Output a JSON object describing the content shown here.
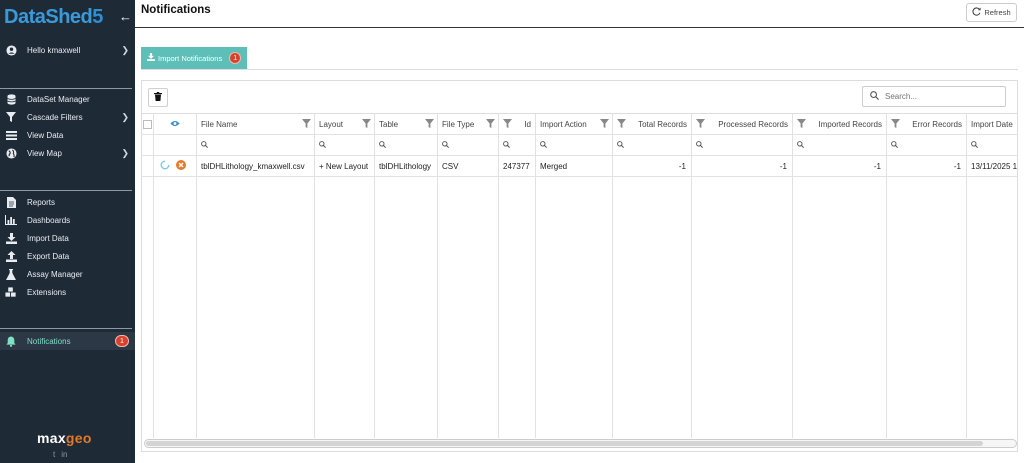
{
  "sidebar": {
    "brand_name": "DataShed",
    "brand_number": "5",
    "user_label": "Hello kmaxwell",
    "items": [
      {
        "label": "DataSet Manager",
        "icon": "database-icon"
      },
      {
        "label": "Cascade Filters",
        "icon": "filter-icon"
      },
      {
        "label": "View Data",
        "icon": "table-icon"
      },
      {
        "label": "View Map",
        "icon": "globe-icon"
      },
      {
        "label": "Reports",
        "icon": "document-icon"
      },
      {
        "label": "Dashboards",
        "icon": "bar-chart-icon"
      },
      {
        "label": "Import Data",
        "icon": "download-icon"
      },
      {
        "label": "Export Data",
        "icon": "upload-icon"
      },
      {
        "label": "Assay Manager",
        "icon": "flask-icon"
      },
      {
        "label": "Extensions",
        "icon": "cubes-icon"
      }
    ],
    "notifications_label": "Notifications",
    "notifications_count": "1",
    "footer_logo_a": "max",
    "footer_logo_b": "geo",
    "social_twitter": "t",
    "social_linkedin": "in"
  },
  "header": {
    "title": "Notifications",
    "refresh_label": "Refresh"
  },
  "tabs": [
    {
      "label": "Import Notifications",
      "count": "1"
    }
  ],
  "search": {
    "placeholder": "Search..."
  },
  "grid": {
    "columns": [
      "File Name",
      "Layout",
      "Table",
      "File Type",
      "Id",
      "Import Action",
      "Total Records",
      "Processed Records",
      "Imported Records",
      "Error Records",
      "Import Date"
    ],
    "rows": [
      {
        "file_name": "tblDHLithology_kmaxwell.csv",
        "layout": "+ New Layout",
        "table": "tblDHLithology",
        "file_type": "CSV",
        "id": "247377",
        "import_action": "Merged",
        "total_records": "-1",
        "processed_records": "-1",
        "imported_records": "-1",
        "error_records": "-1",
        "import_date": "13/11/2025 1"
      }
    ]
  },
  "colors": {
    "sidebar_bg": "#1f2a37",
    "accent_teal": "#5dbfb8",
    "badge_red": "#d9412f",
    "brand_blue": "#3a9ad9",
    "logo_orange": "#e07a2a"
  }
}
